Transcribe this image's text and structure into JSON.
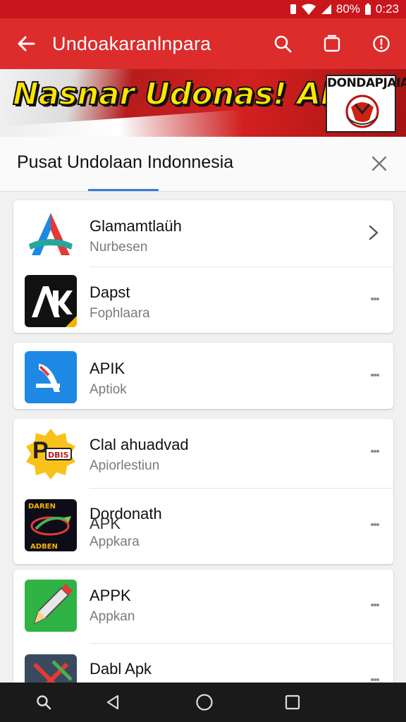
{
  "status_bar": {
    "battery_text": "80%",
    "time": "0:23"
  },
  "app_bar": {
    "title": "Undoakaranlnpara"
  },
  "banner": {
    "headline": "Nasnar Udonas! APK?",
    "emblem_text": "DONDAPJAIA"
  },
  "sheet": {
    "title": "Pusat Undolaan Indonnesia"
  },
  "apps": [
    {
      "name": "Glamamtlaüh",
      "sub": "Nurbesen"
    },
    {
      "name": "Dapst",
      "sub": "Fophlaara"
    },
    {
      "name": "APIK",
      "sub": "Aptiok"
    },
    {
      "name": "Clal ahuadvad",
      "sub": "Apiorlestiun",
      "badge": "DBIS"
    },
    {
      "name": "Dordonath",
      "name_overlay": "APK",
      "sub": "Appkara",
      "icon_text_top": "DAREN",
      "icon_text_bottom": "ADBEN"
    },
    {
      "name": "APPK",
      "sub": "Appkan"
    },
    {
      "name": "Dabl Apk",
      "sub": ""
    }
  ],
  "colors": {
    "appbar": "#dd2c2c",
    "statusbar": "#c9161c",
    "accent": "#3a7bd5"
  }
}
